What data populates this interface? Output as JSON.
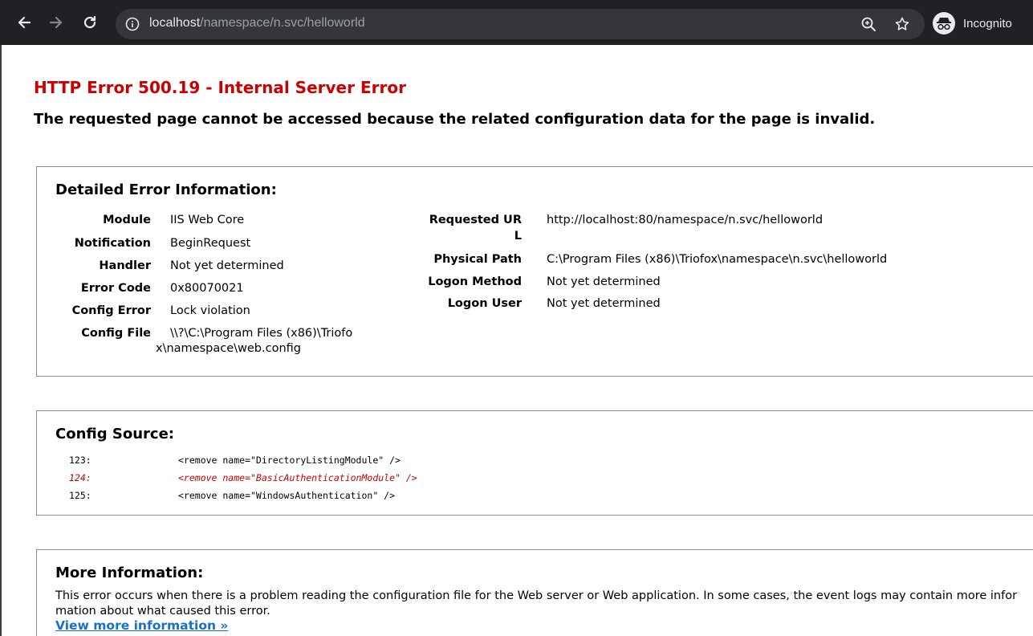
{
  "browser": {
    "url_host": "localhost",
    "url_path": "/namespace/n.svc/helloworld",
    "profile_label": "Incognito",
    "icons": [
      "back-icon",
      "forward-icon",
      "reload-icon",
      "info-icon",
      "zoom-icon",
      "star-icon",
      "incognito-icon"
    ]
  },
  "page": {
    "title": "HTTP Error 500.19 - Internal Server Error",
    "subtitle": "The requested page cannot be accessed because the related configuration data for the page is invalid.",
    "title_color": "#cc0000"
  },
  "detail": {
    "heading": "Detailed Error Information:",
    "left": [
      {
        "label": "Module",
        "value": "IIS Web Core"
      },
      {
        "label": "Notification",
        "value": "BeginRequest"
      },
      {
        "label": "Handler",
        "value": "Not yet determined"
      },
      {
        "label": "Error Code",
        "value": "0x80070021"
      },
      {
        "label": "Config Error",
        "value": "Lock violation"
      },
      {
        "label": "Config File",
        "value_line1": "\\\\?\\C:\\Program Files (x86)\\Triofo",
        "value_line2": "x\\namespace\\web.config"
      }
    ],
    "right": [
      {
        "label_line1": "Requested UR",
        "label_line2": "L",
        "value": "http://localhost:80/namespace/n.svc/helloworld"
      },
      {
        "label": "Physical Path",
        "value": "C:\\Program Files (x86)\\Triofox\\namespace\\n.svc\\helloworld"
      },
      {
        "label": "Logon Method",
        "value": "Not yet determined"
      },
      {
        "label": "Logon User",
        "value": "Not yet determined"
      }
    ]
  },
  "source": {
    "heading": "Config Source:",
    "lines": [
      {
        "num": "123:",
        "code": "<remove name=\"DirectoryListingModule\" />"
      },
      {
        "num": "124:",
        "code": "<remove name=\"BasicAuthenticationModule\" />"
      },
      {
        "num": "125:",
        "code": "<remove name=\"WindowsAuthentication\" />"
      }
    ]
  },
  "more": {
    "heading": "More Information:",
    "text": "This error occurs when there is a problem reading the configuration file for the Web server or Web application. In some cases, the event logs may contain more information about what caused this error.",
    "link": "View more information »",
    "link_color": "#1a6fc6"
  }
}
